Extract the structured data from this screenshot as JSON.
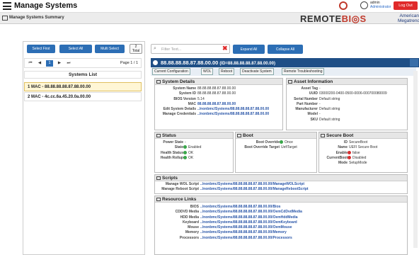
{
  "header": {
    "title": "Manage Systems",
    "user_name": "admin",
    "user_role": "Administrator",
    "logout": "Log Out"
  },
  "subheader": {
    "label": "Manage Systems Summary",
    "brand_left": "REMOTE",
    "brand_mid": "BI",
    "brand_right": "S",
    "ami_line1": "American",
    "ami_line2": "Megatrends"
  },
  "left": {
    "select_first": "Select First",
    "select_all": "Select All",
    "multi_select": "Multi Select",
    "total_count": "2",
    "total_label": "Total",
    "page_current": "1",
    "page_info": "Page 1 / 1",
    "list_title": "Systems List",
    "systems": [
      "1 MAC - 88.88.88.88.87.88.00.00",
      "2 MAC - 4c.cc.6a.45.20.0a.00.00"
    ]
  },
  "search": {
    "placeholder": "Filter Text...",
    "expand": "Expand All",
    "collapse": "Collapse All"
  },
  "system": {
    "title": "88.88.88.88.87.88.00.00",
    "id": "(ID=88.88.88.88.87.88.00.00)"
  },
  "actions": [
    "Current Configuration",
    "WOL",
    "Reboot",
    "Deactivate System",
    "Remote Troubleshooting"
  ],
  "details": {
    "title": "System Details",
    "keys": [
      "System Name",
      "System ID",
      "BIOS Version",
      "MAC",
      "Edit System Details",
      "Manage Credentials"
    ],
    "vals": [
      "88.88.88.88.87.88.00.00",
      "88.88.88.88.87.88.00.00",
      "5.14",
      "88.88.88.88.87.88.00.00",
      "../nonbmc/Systems/88.88.88.88.87.88.00.00",
      "../nonbmc/Systems/88.88.88.88.87.88.00.00"
    ]
  },
  "asset": {
    "title": "Asset Information",
    "keys": [
      "Asset Tag",
      "UUID",
      "Serial Number",
      "Part Number",
      "Manufacturer",
      "Model",
      "SKU"
    ],
    "vals": [
      "-",
      "03000200-0400-0500-0006-000700080009",
      "Default string",
      "-",
      "Default string",
      "-",
      "Default string"
    ]
  },
  "status": {
    "title": "Status",
    "keys": [
      "Power State",
      "State",
      "Health Status",
      "Health Rollup"
    ],
    "vals": [
      "-",
      "Enabled",
      "OK",
      "OK"
    ]
  },
  "boot": {
    "title": "Boot",
    "keys": [
      "Boot Override",
      "Boot Override Target"
    ],
    "vals": [
      "Once",
      "UefiTarget"
    ]
  },
  "secure": {
    "title": "Secure Boot",
    "keys": [
      "ID",
      "Name",
      "Enable",
      "CurrentBoot",
      "Mode"
    ],
    "vals": [
      "SecureBoot",
      "UEFI Secure Boot",
      "false",
      "Disabled",
      "SetupMode"
    ]
  },
  "scripts": {
    "title": "Scripts",
    "keys": [
      "Manage WOL Script",
      "Manage Reboot Script"
    ],
    "vals": [
      "../nonbmc/Systems/88.88.88.88.87.88.00.00/ManageWOLScript",
      "../nonbmc/Systems/88.88.88.88.87.88.00.00/ManageRebootScript"
    ]
  },
  "resources": {
    "title": "Resource Links",
    "keys": [
      "BIOS",
      "CDDVD Media",
      "HDD Media",
      "Keyboard",
      "Mouse",
      "Memory",
      "Processors"
    ],
    "vals": [
      "../nonbmc/Systems/88.88.88.88.87.88.00.00/Bios",
      "../nonbmc/Systems/88.88.88.88.87.88.00.00/OemCdDvdMedia",
      "../nonbmc/Systems/88.88.88.88.87.88.00.00/OemHddMedia",
      "../nonbmc/Systems/88.88.88.88.87.88.00.00/OemKeyboard",
      "../nonbmc/Systems/88.88.88.88.87.88.00.00/OemMouse",
      "../nonbmc/Systems/88.88.88.88.87.88.00.00/Memory",
      "../nonbmc/Systems/88.88.88.88.87.88.00.00/Processors"
    ]
  }
}
